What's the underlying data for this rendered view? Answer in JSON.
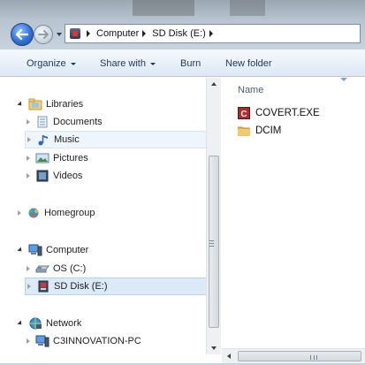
{
  "address": {
    "crumbs": [
      "Computer",
      "SD Disk (E:)"
    ]
  },
  "toolbar": {
    "organize": "Organize",
    "share_with": "Share with",
    "burn": "Burn",
    "new_folder": "New folder"
  },
  "nav": {
    "libraries": "Libraries",
    "documents": "Documents",
    "music": "Music",
    "pictures": "Pictures",
    "videos": "Videos",
    "homegroup": "Homegroup",
    "computer": "Computer",
    "os": "OS (C:)",
    "sd_disk": "SD Disk (E:)",
    "network": "Network",
    "pc": "C3INNOVATION-PC"
  },
  "content": {
    "column_name": "Name",
    "files": [
      {
        "name": "COVERT.EXE",
        "icon": "exe-icon"
      },
      {
        "name": "DCIM",
        "icon": "folder-icon"
      }
    ]
  },
  "colors": {
    "accent": "#2f72d8",
    "selection": "#dceaf8",
    "folder": "#e6b84a"
  }
}
